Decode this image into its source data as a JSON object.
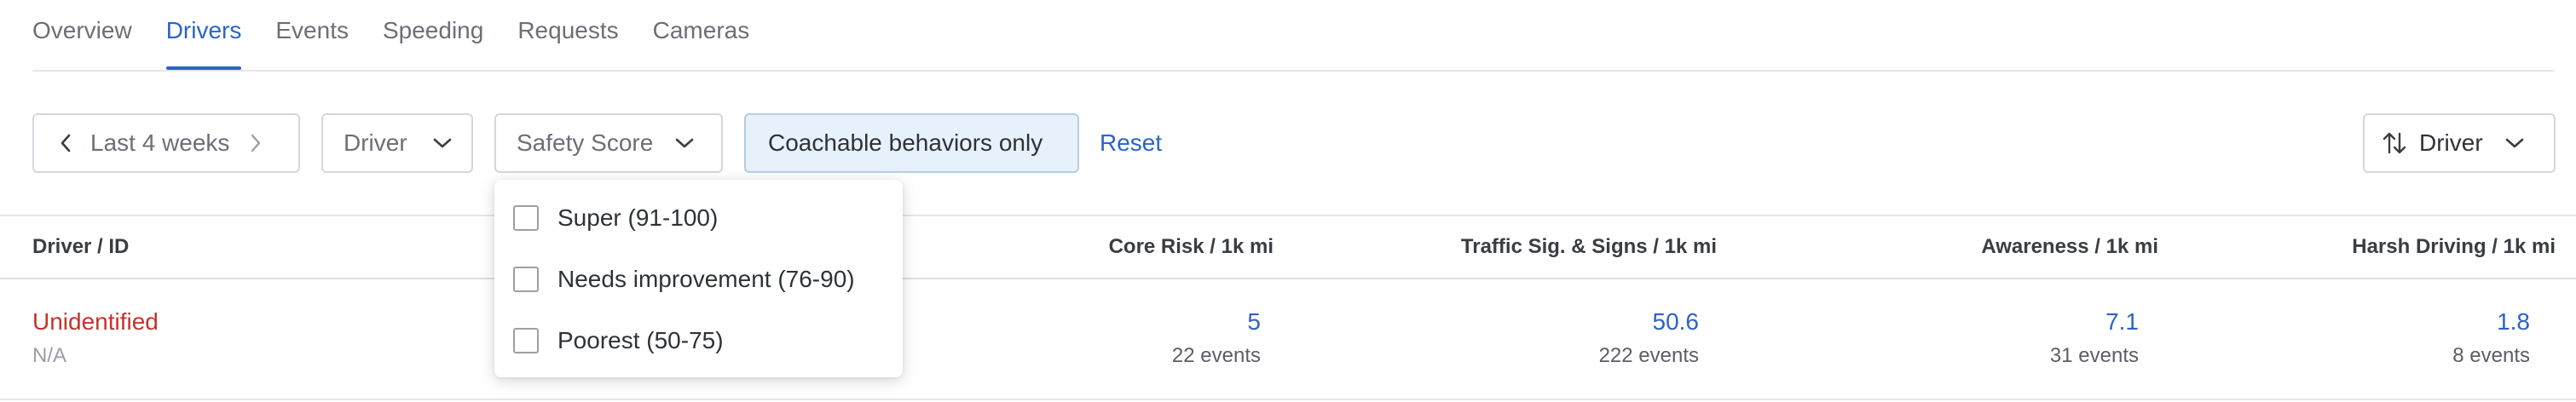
{
  "tabs": [
    {
      "label": "Overview",
      "active": false
    },
    {
      "label": "Drivers",
      "active": true
    },
    {
      "label": "Events",
      "active": false
    },
    {
      "label": "Speeding",
      "active": false
    },
    {
      "label": "Requests",
      "active": false
    },
    {
      "label": "Cameras",
      "active": false
    }
  ],
  "filters": {
    "date_range": "Last 4 weeks",
    "driver": "Driver",
    "safety_score": "Safety Score",
    "coachable": "Coachable behaviors only",
    "reset": "Reset"
  },
  "sort": {
    "label": "Driver"
  },
  "safety_score_options": [
    {
      "label": "Super (91-100)",
      "checked": false
    },
    {
      "label": "Needs improvement (76-90)",
      "checked": false
    },
    {
      "label": "Poorest (50-75)",
      "checked": false
    }
  ],
  "table": {
    "columns": [
      "Driver / ID",
      "Core Risk / 1k mi",
      "Traffic Sig. & Signs / 1k mi",
      "Awareness / 1k mi",
      "Harsh Driving / 1k mi"
    ],
    "rows": [
      {
        "driver": "Unidentified",
        "id": "N/A",
        "core_risk": {
          "value": "5",
          "events": "22 events"
        },
        "traffic_signs": {
          "value": "50.6",
          "events": "222 events"
        },
        "awareness": {
          "value": "7.1",
          "events": "31 events"
        },
        "harsh_driving": {
          "value": "1.8",
          "events": "8 events"
        }
      }
    ]
  },
  "colors": {
    "accent": "#2c63c8",
    "driver_name": "#c4342a",
    "coachable_bg": "#e7f1fb"
  }
}
